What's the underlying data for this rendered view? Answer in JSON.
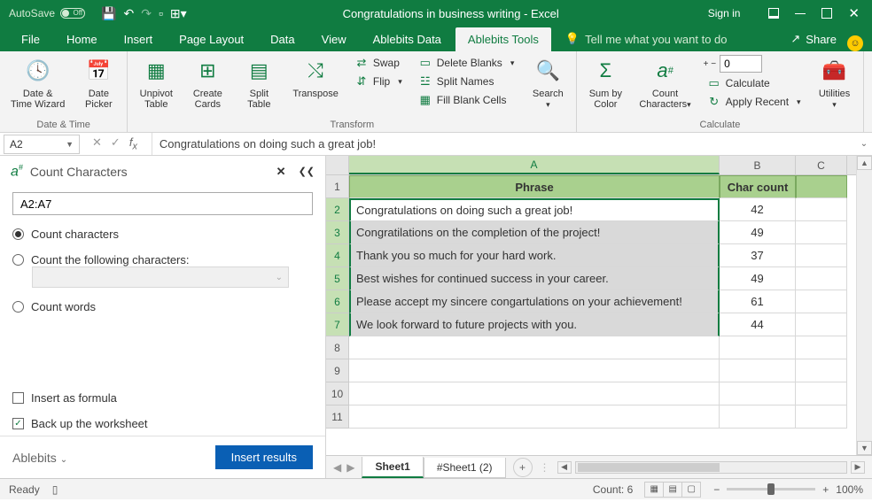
{
  "titlebar": {
    "autosave": "AutoSave",
    "autosave_state": "Off",
    "title": "Congratulations in business writing  -  Excel",
    "signin": "Sign in"
  },
  "menu": {
    "file": "File",
    "home": "Home",
    "insert": "Insert",
    "pagelayout": "Page Layout",
    "data": "Data",
    "view": "View",
    "abdata": "Ablebits Data",
    "abtools": "Ablebits Tools",
    "tellme": "Tell me what you want to do",
    "share": "Share"
  },
  "ribbon": {
    "datetime": {
      "wizard": "Date &\nTime Wizard",
      "picker": "Date\nPicker",
      "group": "Date & Time"
    },
    "transform": {
      "unpivot": "Unpivot\nTable",
      "cards": "Create\nCards",
      "split": "Split\nTable",
      "transpose": "Transpose",
      "swap": "Swap",
      "flip": "Flip",
      "delblanks": "Delete Blanks",
      "splitnames": "Split Names",
      "fillblanks": "Fill Blank Cells",
      "search": "Search",
      "group": "Transform"
    },
    "calc": {
      "sumcolor": "Sum by\nColor",
      "countchar": "Count\nCharacters",
      "num": "0",
      "calculate": "Calculate",
      "applyrecent": "Apply Recent",
      "utilities": "Utilities",
      "group": "Calculate"
    }
  },
  "formulabar": {
    "name": "A2",
    "formula": "Congratulations on doing such a great job!"
  },
  "panel": {
    "title": "Count Characters",
    "range": "A2:A7",
    "opt_chars": "Count characters",
    "opt_following": "Count the following characters:",
    "opt_words": "Count words",
    "chk_formula": "Insert as formula",
    "chk_backup": "Back up the worksheet",
    "brand": "Ablebits",
    "btn": "Insert results"
  },
  "grid": {
    "colA": "A",
    "colB": "B",
    "colC": "C",
    "head_phrase": "Phrase",
    "head_count": "Char count",
    "rows": [
      {
        "n": "2",
        "phrase": "Congratulations on doing such a great job!",
        "count": "42"
      },
      {
        "n": "3",
        "phrase": "Congratilations on the completion of the project!",
        "count": "49"
      },
      {
        "n": "4",
        "phrase": "Thank you so much for your hard work.",
        "count": "37"
      },
      {
        "n": "5",
        "phrase": "Best wishes for continued success in your career.",
        "count": "49"
      },
      {
        "n": "6",
        "phrase": "Please accept my sincere congartulations on your achievement!",
        "count": "61"
      },
      {
        "n": "7",
        "phrase": "We look forward to future projects with you.",
        "count": "44"
      }
    ]
  },
  "tabs": {
    "sheet1": "Sheet1",
    "sheet1b": "#Sheet1 (2)"
  },
  "status": {
    "ready": "Ready",
    "count": "Count: 6",
    "zoom": "100%"
  }
}
